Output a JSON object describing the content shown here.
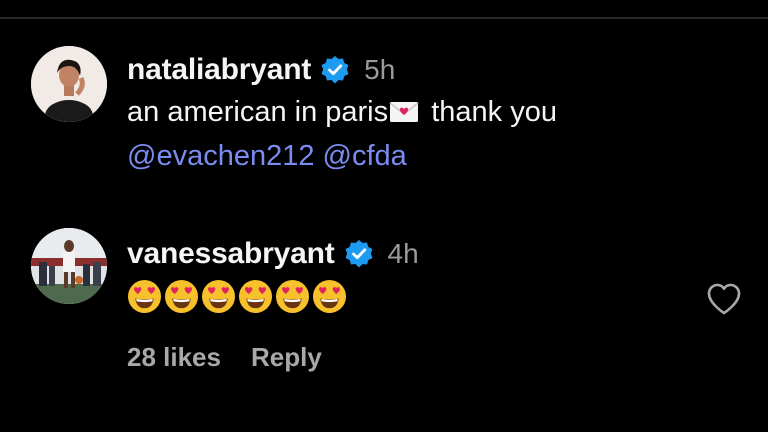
{
  "comments": [
    {
      "username": "nataliabryant",
      "time": "5h",
      "text_before": "an american in paris",
      "text_after": " thank you",
      "mentions": [
        "@evachen212",
        "@cfda"
      ],
      "avatar_icon": "profile-photo-woman",
      "emoji_icon": "envelope-heart-icon"
    },
    {
      "username": "vanessabryant",
      "time": "4h",
      "emoji_icon": "heart-eyes-emoji",
      "emoji_count": 6,
      "avatar_icon": "profile-photo-basketball",
      "likes": "28 likes",
      "reply": "Reply"
    }
  ],
  "colors": {
    "background": "#000000",
    "text": "#f5f5f5",
    "muted": "#a8a8a8",
    "mention": "#7b8cf0",
    "verified": "#1d9bf0"
  }
}
